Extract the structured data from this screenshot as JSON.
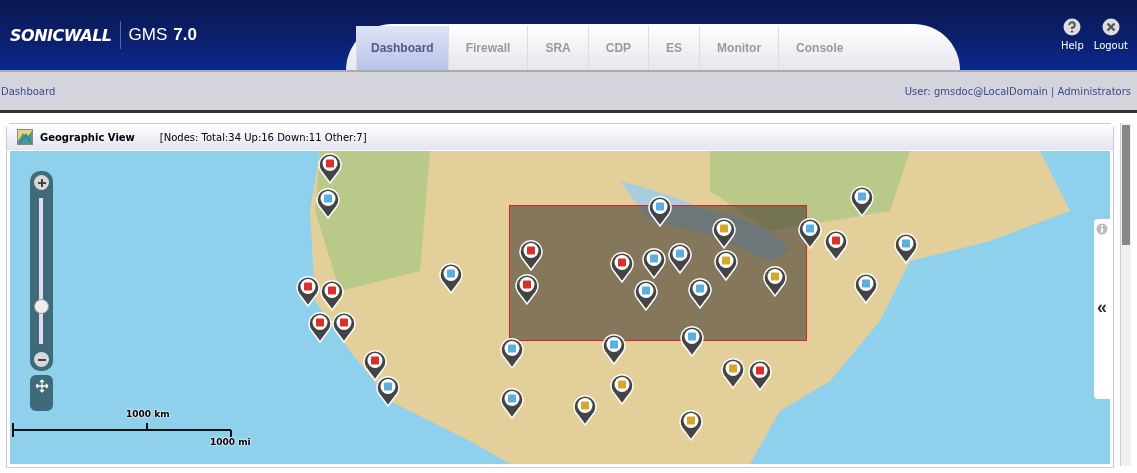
{
  "header": {
    "logo": "SONICWALL",
    "product": "GMS",
    "version": "7.0",
    "tabs": [
      {
        "label": "Dashboard",
        "selected": true
      },
      {
        "label": "Firewall",
        "selected": false
      },
      {
        "label": "SRA",
        "selected": false
      },
      {
        "label": "CDP",
        "selected": false
      },
      {
        "label": "ES",
        "selected": false
      },
      {
        "label": "Monitor",
        "selected": false
      },
      {
        "label": "Console",
        "selected": false
      }
    ],
    "actions": [
      {
        "kind": "help",
        "label": "Help"
      },
      {
        "kind": "logout",
        "label": "Logout"
      }
    ]
  },
  "breadcrumb": "Dashboard",
  "user": "User: gmsdoc@LocalDomain | Administrators",
  "panel": {
    "title": "Geographic View",
    "summary": "[Nodes:  Total:34  Up:16  Down:11  Other:7]",
    "map": {
      "zoom": {
        "level": 0.23
      },
      "scale_km": "1000 km",
      "scale_mi": "1000 mi",
      "collapse": "«",
      "markers": [
        {
          "color": "#d8302a"
        },
        {
          "color": "#5aaee0"
        },
        {
          "color": "#d8302a"
        },
        {
          "color": "#d8302a"
        },
        {
          "color": "#d8302a"
        },
        {
          "color": "#d8302a"
        },
        {
          "color": "#5aaee0"
        },
        {
          "color": "#5aaee0"
        },
        {
          "color": "#5aaee0"
        },
        {
          "color": "#5aaee0"
        },
        {
          "color": "#d8302a"
        },
        {
          "color": "#d8302a"
        },
        {
          "color": "#5aaee0"
        },
        {
          "color": "#d8302a"
        },
        {
          "color": "#5aaee0"
        },
        {
          "color": "#5aaee0"
        },
        {
          "color": "#5aaee0"
        },
        {
          "color": "#5aaee0"
        },
        {
          "color": "#d9a62c"
        },
        {
          "color": "#d9a62c"
        },
        {
          "color": "#d9a62c"
        },
        {
          "color": "#5aaee0"
        },
        {
          "color": "#d8302a"
        },
        {
          "color": "#5aaee0"
        },
        {
          "color": "#5aaee0"
        },
        {
          "color": "#5aaee0"
        },
        {
          "color": "#d8302a"
        },
        {
          "color": "#5aaee0"
        },
        {
          "color": "#d9a62c"
        },
        {
          "color": "#d9a62c"
        },
        {
          "color": "#d9a62c"
        },
        {
          "color": "#d8302a"
        },
        {
          "color": "#d9a62c"
        },
        {
          "color": "#5aaee0"
        }
      ]
    }
  }
}
